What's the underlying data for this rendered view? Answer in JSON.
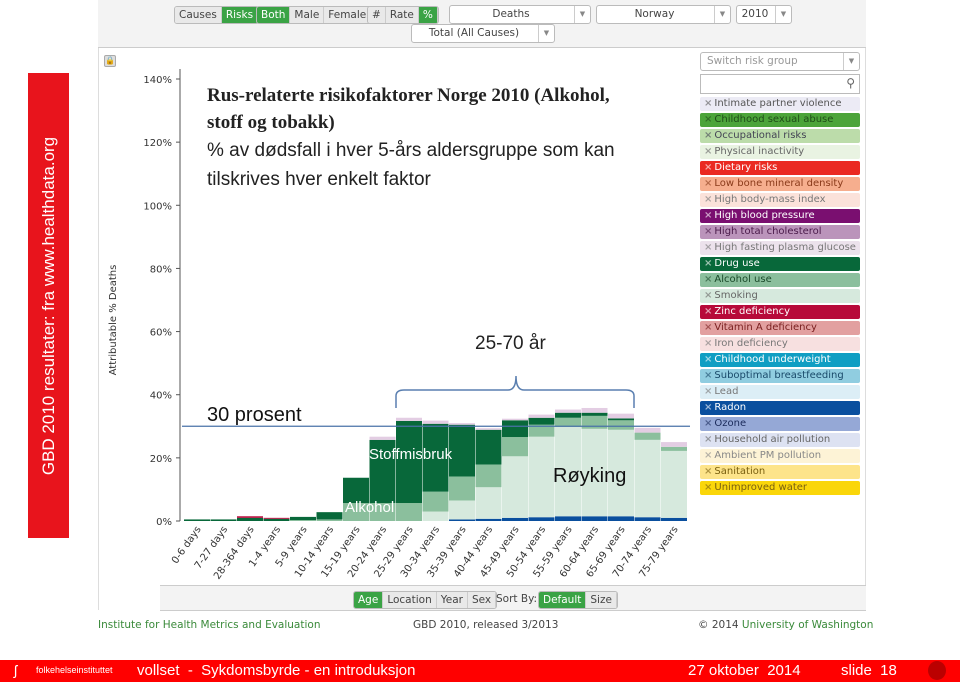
{
  "side_banner": "GBD 2010 resultater: fra www.healthdata.org",
  "toolbar": {
    "causes_risks": [
      {
        "label": "Causes",
        "on": false
      },
      {
        "label": "Risks",
        "on": true
      }
    ],
    "sex": [
      {
        "label": "Both",
        "on": true
      },
      {
        "label": "Male",
        "on": false
      },
      {
        "label": "Female",
        "on": false
      }
    ],
    "metric": [
      {
        "label": "#",
        "on": false
      },
      {
        "label": "Rate",
        "on": false
      },
      {
        "label": "%",
        "on": true
      }
    ],
    "measure": "Deaths",
    "location": "Norway",
    "year": "2010",
    "cause": "Total (All Causes)"
  },
  "legend": {
    "switch_placeholder": "Switch risk group",
    "items": [
      {
        "label": "Intimate partner violence",
        "bg": "#ecebf5",
        "fg": "#555"
      },
      {
        "label": "Childhood sexual abuse",
        "bg": "#4ca43a",
        "fg": "#1f4d18"
      },
      {
        "label": "Occupational risks",
        "bg": "#bcdcaa",
        "fg": "#445"
      },
      {
        "label": "Physical inactivity",
        "bg": "#e9f3e2",
        "fg": "#666"
      },
      {
        "label": "Dietary risks",
        "bg": "#ea2a22",
        "fg": "#fff"
      },
      {
        "label": "Low bone mineral density",
        "bg": "#f6ae8e",
        "fg": "#8a3a1a"
      },
      {
        "label": "High body-mass index",
        "bg": "#fbe2da",
        "fg": "#777"
      },
      {
        "label": "High blood pressure",
        "bg": "#7a0f70",
        "fg": "#fff"
      },
      {
        "label": "High total cholesterol",
        "bg": "#bb94bb",
        "fg": "#4a1a4a"
      },
      {
        "label": "High fasting plasma glucose",
        "bg": "#ece2ec",
        "fg": "#777"
      },
      {
        "label": "Drug use",
        "bg": "#08683a",
        "fg": "#fff"
      },
      {
        "label": "Alcohol use",
        "bg": "#8bbf9d",
        "fg": "#1a4a2a"
      },
      {
        "label": "Smoking",
        "bg": "#d6e9dd",
        "fg": "#666"
      },
      {
        "label": "Zinc deficiency",
        "bg": "#b70a3a",
        "fg": "#fff"
      },
      {
        "label": "Vitamin A deficiency",
        "bg": "#e2a0a0",
        "fg": "#7a2020"
      },
      {
        "label": "Iron deficiency",
        "bg": "#f7e0e0",
        "fg": "#777"
      },
      {
        "label": "Childhood underweight",
        "bg": "#109ec3",
        "fg": "#fff"
      },
      {
        "label": "Suboptimal breastfeeding",
        "bg": "#90cde0",
        "fg": "#1a4a6a"
      },
      {
        "label": "Lead",
        "bg": "#dceef6",
        "fg": "#777"
      },
      {
        "label": "Radon",
        "bg": "#0a4f9e",
        "fg": "#fff"
      },
      {
        "label": "Ozone",
        "bg": "#95a8d6",
        "fg": "#1a2a5a"
      },
      {
        "label": "Household air pollution",
        "bg": "#dde2f2",
        "fg": "#666"
      },
      {
        "label": "Ambient PM pollution",
        "bg": "#fdf3d6",
        "fg": "#888"
      },
      {
        "label": "Sanitation",
        "bg": "#fde48a",
        "fg": "#7a6010"
      },
      {
        "label": "Unimproved water",
        "bg": "#fad60a",
        "fg": "#7a6010"
      }
    ]
  },
  "annotation": {
    "title": "Rus-relaterte risikofaktorer Norge 2010 (Alkohol, stoff og tobakk)",
    "subtitle": "% av dødsfall i hver 5-års aldersgruppe som kan tilskrives hver enkelt faktor",
    "age_range": "25-70 år",
    "thirty": "30 prosent",
    "drug": "Stoffmisbruk",
    "alcohol": "Alkohol",
    "smoking": "Røyking"
  },
  "chart_data": {
    "type": "bar",
    "stacked": true,
    "ylabel": "Attributable % Deaths",
    "ylim": [
      0,
      140
    ],
    "yticks": [
      "0%",
      "20%",
      "40%",
      "60%",
      "80%",
      "100%",
      "120%",
      "140%"
    ],
    "reference_line": 30,
    "categories": [
      "0-6 days",
      "7-27 days",
      "28-364 days",
      "1-4 years",
      "5-9 years",
      "10-14 years",
      "15-19 years",
      "20-24 years",
      "25-29 years",
      "30-34 years",
      "35-39 years",
      "40-44 years",
      "45-49 years",
      "50-54 years",
      "55-59 years",
      "60-64 years",
      "65-69 years",
      "70-74 years",
      "75-79 years"
    ],
    "series": [
      {
        "name": "Radon",
        "color": "#0a4f9e",
        "values": [
          0,
          0,
          0,
          0,
          0,
          0,
          0,
          0,
          0,
          0,
          0.5,
          0.7,
          1,
          1.2,
          1.5,
          1.5,
          1.5,
          1.2,
          1
        ]
      },
      {
        "name": "Smoking",
        "color": "#d6e9dd",
        "values": [
          0,
          0,
          0,
          0,
          0,
          0,
          0,
          0,
          0,
          3,
          6,
          10,
          19.5,
          25.5,
          28.3,
          27.7,
          27.4,
          24.5,
          21.2
        ]
      },
      {
        "name": "Alcohol use",
        "color": "#8bbf9d",
        "values": [
          0,
          0,
          0,
          0,
          0.3,
          0.5,
          5.7,
          5.7,
          5.7,
          6.3,
          7.6,
          7.2,
          6.1,
          3.8,
          2.9,
          4.1,
          3,
          2.3,
          1.3
        ]
      },
      {
        "name": "Drug use",
        "color": "#08683a",
        "values": [
          0.5,
          0.5,
          1,
          0.7,
          1,
          2.3,
          8,
          20,
          26,
          21.5,
          16.4,
          11,
          5.3,
          2.2,
          1.6,
          1,
          0.6,
          0,
          0
        ]
      },
      {
        "name": "Zinc deficiency",
        "color": "#b70a3a",
        "values": [
          0,
          0,
          0.5,
          0.3,
          0,
          0,
          0,
          0,
          0,
          0,
          0,
          0,
          0,
          0,
          0,
          0,
          0,
          0,
          0
        ]
      },
      {
        "name": "High total cholesterol",
        "color": "#e3cde3",
        "values": [
          0,
          0,
          0,
          0,
          0,
          0,
          0,
          1,
          1,
          1,
          0.5,
          0.5,
          0.5,
          1,
          1,
          1.5,
          1.5,
          1.5,
          1.5
        ]
      }
    ]
  },
  "bottom_bar": {
    "groups": [
      {
        "label": "Age",
        "on": true
      },
      {
        "label": "Location",
        "on": false
      },
      {
        "label": "Year",
        "on": false
      },
      {
        "label": "Sex",
        "on": false
      }
    ],
    "sort_label": "Sort By:",
    "sort": [
      {
        "label": "Default",
        "on": true
      },
      {
        "label": "Size",
        "on": false
      }
    ]
  },
  "footer": {
    "left": "Institute for Health Metrics and Evaluation",
    "center": "GBD 2010, released 3/2013",
    "copyright": "© 2014",
    "right": "University of Washington"
  },
  "slide_footer": {
    "logo": "folkehelseinstituttet",
    "text": "vollset  -  Sykdomsbyrde - en introduksjon",
    "date": "27 oktober  2014",
    "slide": "slide  18"
  }
}
